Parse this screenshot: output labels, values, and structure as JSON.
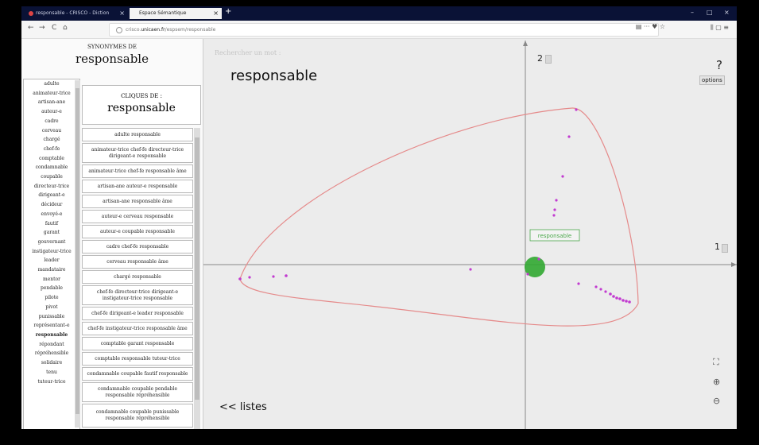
{
  "browser": {
    "tabs": [
      {
        "label": "responsable - CRISCO - Diction",
        "active": false
      },
      {
        "label": "Espace Sémantique",
        "active": true
      }
    ],
    "new_tab": "+",
    "url_prefix": "crisco.",
    "url_domain": "unicaen.fr",
    "url_path": "/espsem/responsable",
    "nav": {
      "back": "←",
      "forward": "→",
      "reload": "C",
      "home": "⌂"
    },
    "url_icons": "▤  ···  ♥  ☆",
    "right_icons": "⫼  ▢  ≡",
    "window_controls": {
      "minimize": "–",
      "maximize": "□",
      "close": "×"
    }
  },
  "synonymes": {
    "header": "SYNONYMES DE",
    "word": "responsable",
    "items": [
      "adulte",
      "animateur-trice",
      "artisan-ane",
      "auteur-e",
      "cadre",
      "cerveau",
      "chargé",
      "chef-fe",
      "comptable",
      "condamnable",
      "coupable",
      "directeur-trice",
      "dirigeant-e",
      "décideur",
      "envoyé-e",
      "fautif",
      "garant",
      "gouvernant",
      "instigateur-trice",
      "leader",
      "mandataire",
      "mentor",
      "pendable",
      "pilote",
      "pivot",
      "punissable",
      "représentant-e",
      "responsable",
      "répondant",
      "répréhensible",
      "solidaire",
      "tenu",
      "tuteur-trice"
    ],
    "selected": "responsable"
  },
  "cliques": {
    "header": "CLIQUES DE :",
    "word": "responsable",
    "items": [
      "adulte responsable",
      "animateur-trice chef-fe directeur-trice dirigeant-e responsable",
      "animateur-trice chef-fe responsable âme",
      "artisan-ane auteur-e responsable",
      "artisan-ane responsable âme",
      "auteur-e cerveau responsable",
      "auteur-e coupable responsable",
      "cadre chef-fe responsable",
      "cerveau responsable âme",
      "chargé responsable",
      "chef-fe directeur-trice dirigeant-e instigateur-trice responsable",
      "chef-fe dirigeant-e leader responsable",
      "chef-fe instigateur-trice responsable âme",
      "comptable garant responsable",
      "comptable responsable tuteur-trice",
      "condamnable coupable fautif responsable",
      "condamnable coupable pendable responsable répréhensible",
      "condamnable coupable punissable responsable répréhensible"
    ]
  },
  "graph": {
    "search_placeholder": "Rechercher un mot :",
    "title": "responsable",
    "axis_y_label": "2",
    "axis_x_label": "1",
    "help": "?",
    "options_label": "options",
    "back_link": "<< listes",
    "fullscreen_icon": "⛶",
    "zoom_in_icon": "⊕",
    "zoom_out_icon": "⊖",
    "point_label": "responsable",
    "colors": {
      "points": "#c23bd0",
      "ellipse": "#e58a8a",
      "center": "#31a831",
      "label": "#4aa84a"
    }
  }
}
